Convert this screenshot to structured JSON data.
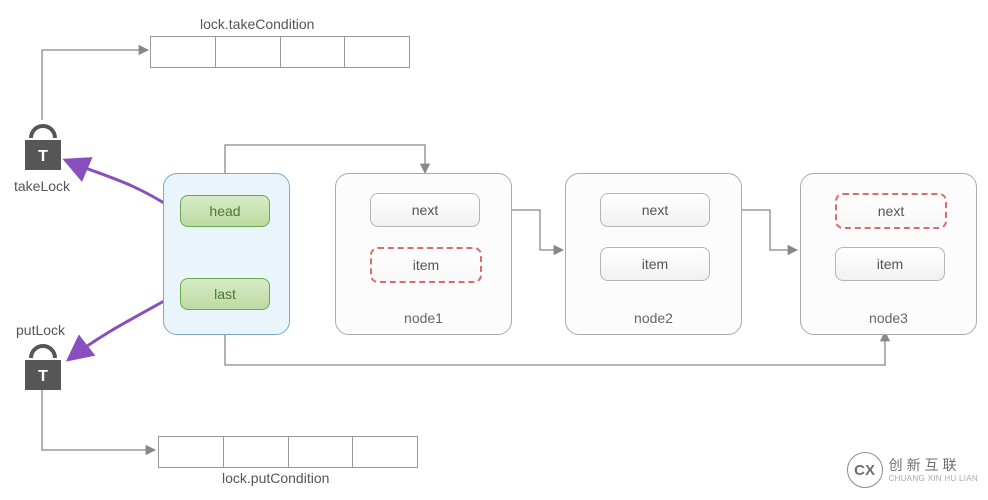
{
  "topQueueLabel": "lock.takeCondition",
  "bottomQueueLabel": "lock.putCondition",
  "takeLockLabel": "takeLock",
  "putLockLabel": "putLock",
  "struct": {
    "head": "head",
    "last": "last"
  },
  "nodes": [
    {
      "name": "node1",
      "next": "next",
      "item": "item",
      "itemDashed": true,
      "nextDashed": false
    },
    {
      "name": "node2",
      "next": "next",
      "item": "item",
      "itemDashed": false,
      "nextDashed": false
    },
    {
      "name": "node3",
      "next": "next",
      "item": "item",
      "itemDashed": false,
      "nextDashed": true
    }
  ],
  "watermark": {
    "logo": "CX",
    "cn": "创新互联",
    "py": "CHUANG XIN HU LIAN"
  }
}
